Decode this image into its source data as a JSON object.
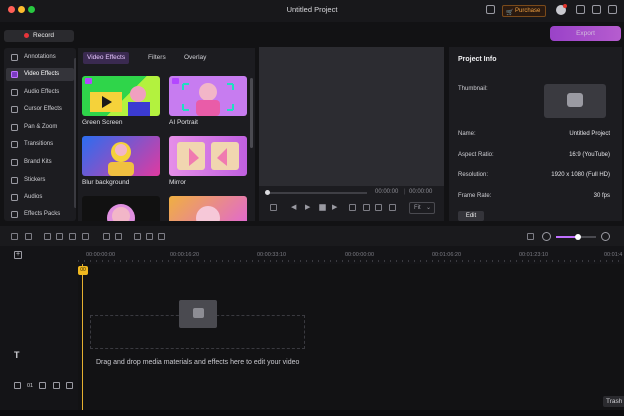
{
  "window": {
    "title": "Untitled Project"
  },
  "titlebar": {
    "purchase_label": "Purchase"
  },
  "toolbar": {
    "record_label": "Record",
    "export_label": "Export"
  },
  "sidebar": {
    "items": [
      {
        "label": "Annotations",
        "icon": "annotation-icon"
      },
      {
        "label": "Video Effects",
        "icon": "video-effects-icon",
        "active": true
      },
      {
        "label": "Audio Effects",
        "icon": "audio-effects-icon"
      },
      {
        "label": "Cursor Effects",
        "icon": "cursor-icon"
      },
      {
        "label": "Pan & Zoom",
        "icon": "pan-zoom-icon"
      },
      {
        "label": "Transitions",
        "icon": "transitions-icon"
      },
      {
        "label": "Brand Kits",
        "icon": "brand-kit-icon"
      },
      {
        "label": "Stickers",
        "icon": "sticker-icon"
      },
      {
        "label": "Audios",
        "icon": "audio-icon"
      },
      {
        "label": "Effects Packs",
        "icon": "effects-pack-icon"
      }
    ]
  },
  "effects": {
    "tabs": [
      {
        "label": "Video Effects",
        "active": true
      },
      {
        "label": "Filters"
      },
      {
        "label": "Overlay"
      }
    ],
    "items": [
      {
        "label": "Green Screen"
      },
      {
        "label": "AI Portrait"
      },
      {
        "label": "Blur background"
      },
      {
        "label": "Mirror"
      },
      {
        "label": ""
      },
      {
        "label": ""
      }
    ]
  },
  "player": {
    "current_time": "00:00:00",
    "total_time": "00:00:00",
    "fit_label": "Fit"
  },
  "project_info": {
    "title": "Project Info",
    "thumbnail_label": "Thumbnail:",
    "fields": [
      {
        "label": "Name:",
        "value": "Untitled Project"
      },
      {
        "label": "Aspect Ratio:",
        "value": "16:9 (YouTube)"
      },
      {
        "label": "Resolution:",
        "value": "1920 x 1080 (Full HD)"
      },
      {
        "label": "Frame Rate:",
        "value": "30 fps"
      }
    ],
    "edit_label": "Edit"
  },
  "timeline": {
    "ruler_labels": [
      "00:00:00:00",
      "00:00:16:20",
      "00:00:33:10",
      "00:00:00:00",
      "00:01:06:20",
      "00:01:23:10",
      "00:01:4"
    ],
    "drop_text": "Drag and drop media materials and effects here to edit your video",
    "track_number": "01",
    "text_track_label": "T",
    "playhead_label": "00"
  },
  "trash_label": "Trash",
  "colors": {
    "accent": "#b24be8",
    "playhead": "#f0b820",
    "record": "#e7343a"
  }
}
